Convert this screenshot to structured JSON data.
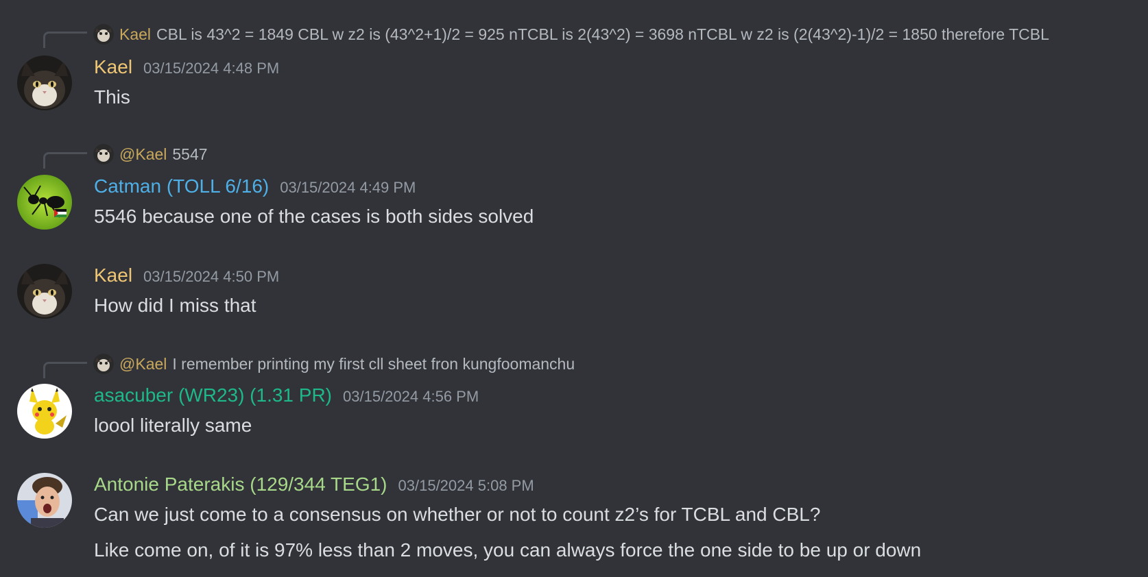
{
  "colors": {
    "background": "#313338",
    "kael": "#f0c674",
    "catman": "#4fb0e8",
    "asacuber": "#1fb88a",
    "antonie": "#a8d88a",
    "text": "#dbdee1",
    "muted": "#949ba4"
  },
  "messages": [
    {
      "reply": {
        "avatar_icon": "cat-avatar-icon",
        "name": "Kael",
        "text": "CBL is 43^2 = 1849 CBL w z2 is (43^2+1)/2 = 925 nTCBL is 2(43^2) = 3698 nTCBL w z2 is (2(43^2)-1)/2 = 1850 therefore TCBL"
      },
      "author": "Kael",
      "avatar_icon": "cat-avatar-icon",
      "timestamp": "03/15/2024 4:48 PM",
      "lines": [
        "This"
      ]
    },
    {
      "reply": {
        "avatar_icon": "cat-avatar-icon",
        "name": "@Kael",
        "text": "5547"
      },
      "author": "Catman (TOLL 6/16)",
      "avatar_icon": "ant-avatar-icon",
      "timestamp": "03/15/2024 4:49 PM",
      "lines": [
        "5546 because one of the cases is both sides solved"
      ]
    },
    {
      "author": "Kael",
      "avatar_icon": "cat-avatar-icon",
      "timestamp": "03/15/2024 4:50 PM",
      "lines": [
        "How did I miss that"
      ]
    },
    {
      "reply": {
        "avatar_icon": "cat-avatar-icon",
        "name": "@Kael",
        "text": "I remember printing my first cll sheet fron kungfoomanchu"
      },
      "author": "asacuber (WR23) (1.31 PR)",
      "avatar_icon": "pikachu-avatar-icon",
      "timestamp": "03/15/2024 4:56 PM",
      "lines": [
        "loool literally same"
      ]
    },
    {
      "author": "Antonie Paterakis (129/344 TEG1)",
      "avatar_icon": "person-avatar-icon",
      "timestamp": "03/15/2024 5:08 PM",
      "lines": [
        "Can we just come to a consensus on whether or not to count z2’s for TCBL and CBL?",
        "Like come on, of it is 97% less than 2 moves, you can always force the one side to be up or down"
      ]
    }
  ]
}
